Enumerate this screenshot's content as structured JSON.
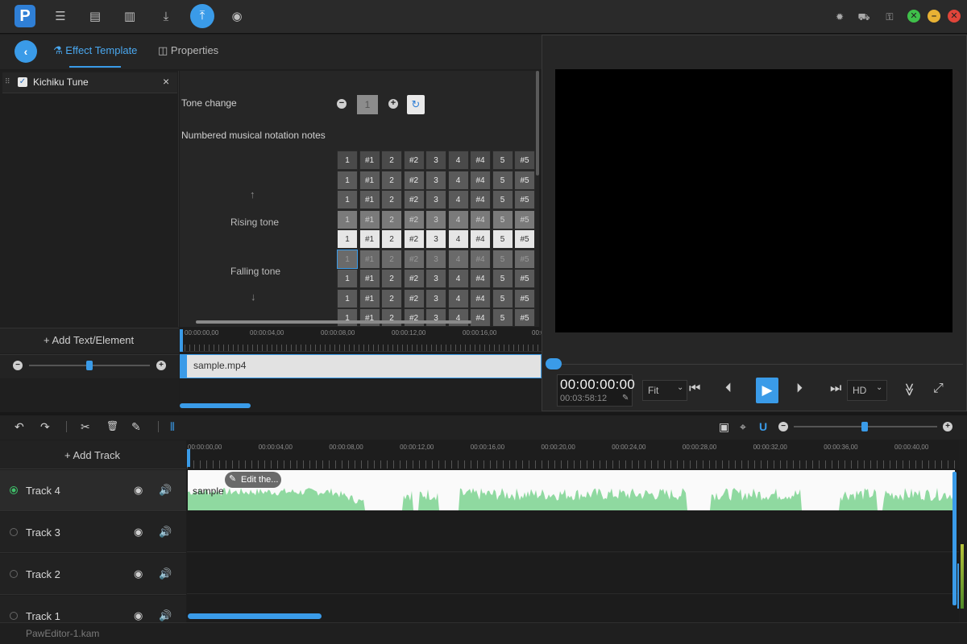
{
  "top_toolbar": {
    "logo_text": "P",
    "icons": [
      "menu-icon",
      "new-project-icon",
      "open-project-icon",
      "download-icon",
      "export-icon",
      "record-icon"
    ],
    "right_icons": [
      "settings-icon",
      "cart-icon",
      "key-icon"
    ],
    "window_buttons": {
      "maximize": "✕",
      "minimize": "–",
      "close": "✕"
    },
    "window_colors": {
      "maximize": "#3fc04a",
      "minimize": "#e8b234",
      "close": "#e0453a"
    }
  },
  "tabs": {
    "back": "‹",
    "effect_template": "Effect Template",
    "properties": "Properties"
  },
  "effect_list": {
    "items": [
      {
        "name": "Kichiku Tune",
        "checked": true
      }
    ],
    "close": "×"
  },
  "effect_properties": {
    "tone_change_label": "Tone change",
    "tone_value": "1",
    "minus": "−",
    "plus": "+",
    "reset": "↻",
    "notation_label": "Numbered musical notation notes",
    "rising_arrow": "↑",
    "rising_label": "Rising tone",
    "falling_label": "Falling tone",
    "falling_arrow": "↓",
    "note_rows": [
      [
        "1",
        "#1",
        "2",
        "#2",
        "3",
        "4",
        "#4",
        "5",
        "#5"
      ],
      [
        "1",
        "#1",
        "2",
        "#2",
        "3",
        "4",
        "#4",
        "5",
        "#5"
      ],
      [
        "1",
        "#1",
        "2",
        "#2",
        "3",
        "4",
        "#4",
        "5",
        "#5"
      ],
      [
        "1",
        "#1",
        "2",
        "#2",
        "3",
        "4",
        "#4",
        "5",
        "#5"
      ],
      [
        "1",
        "#1",
        "2",
        "#2",
        "3",
        "4",
        "#4",
        "5",
        "#5"
      ],
      [
        "1",
        "#1",
        "2",
        "#2",
        "3",
        "4",
        "#4",
        "5",
        "#5"
      ],
      [
        "1",
        "#1",
        "2",
        "#2",
        "3",
        "4",
        "#4",
        "5",
        "#5"
      ],
      [
        "1",
        "#1",
        "2",
        "#2",
        "3",
        "4",
        "#4",
        "5",
        "#5"
      ],
      [
        "1",
        "#1",
        "2",
        "#2",
        "3",
        "4",
        "#4",
        "5",
        "#5"
      ]
    ]
  },
  "left_panel": {
    "add_text_element": "Add Text/Element",
    "zoom_minus": "−",
    "zoom_plus": "+"
  },
  "mini_timeline": {
    "ticks": [
      "00:00:00,00",
      "00:00:04,00",
      "00:00:08,00",
      "00:00:12,00",
      "00:00:16,00",
      "00:00"
    ],
    "clip_name": "sample.mp4"
  },
  "preview": {
    "current_time": "00:00:00:00",
    "total_time": "00:03:58:12",
    "edit_icon": "✎",
    "fit_option": "Fit",
    "quality_option": "HD",
    "caret": "⌄",
    "buttons": {
      "skip_start": "⏮",
      "prev_frame": "⏴",
      "play": "▶",
      "next_frame": "⏵",
      "skip_end": "⏭",
      "more": "≫",
      "fullscreen": "⤢"
    }
  },
  "timeline_toolbar": {
    "undo": "↶",
    "redo": "↷",
    "cut": "✂",
    "delete": "🗑",
    "edit": "✎",
    "split": "⫴",
    "snapshot": "▣",
    "marker": "⌖",
    "magnet": "U",
    "zoom_minus": "−",
    "zoom_plus": "+"
  },
  "tracks_panel": {
    "add_track": "Add Track",
    "eye": "◉",
    "volume": "🔊",
    "tracks": [
      {
        "name": "Track 4",
        "active": true
      },
      {
        "name": "Track 3",
        "active": false
      },
      {
        "name": "Track 2",
        "active": false
      },
      {
        "name": "Track 1",
        "active": false
      }
    ]
  },
  "timeline": {
    "ticks": [
      "00:00:00,00",
      "00:00:04,00",
      "00:00:08,00",
      "00:00:12,00",
      "00:00:16,00",
      "00:00:20,00",
      "00:00:24,00",
      "00:00:28,00",
      "00:00:32,00",
      "00:00:36,00",
      "00:00:40,00"
    ],
    "clip_name": "sample",
    "edit_badge": "Edit the...",
    "edit_pen": "✎",
    "wave_color": "#8fd9a0"
  },
  "status": {
    "project_name": "PawEditor-1.kam"
  }
}
